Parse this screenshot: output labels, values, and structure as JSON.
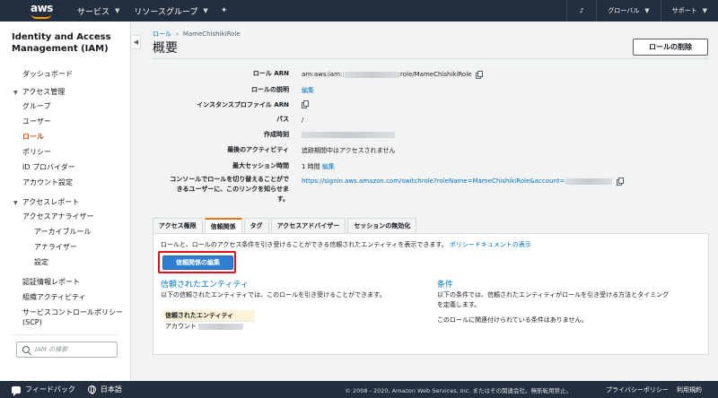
{
  "topnav": {
    "logo_text": "aws",
    "services": "サービス",
    "resource_groups": "リソースグループ",
    "pin_icon": "pin-icon",
    "region": "グローバル",
    "support": "サポート"
  },
  "sidebar": {
    "title": "Identity and Access Management (IAM)",
    "dashboard": "ダッシュボード",
    "access_mgmt": "アクセス管理",
    "groups": "グループ",
    "users": "ユーザー",
    "roles": "ロール",
    "policies": "ポリシー",
    "id_providers": "ID プロバイダー",
    "account_settings": "アカウント設定",
    "access_reports": "アクセスレポート",
    "access_analyzer": "アクセスアナライザー",
    "archive_rules": "アーカイブルール",
    "analyzers": "アナライザー",
    "settings": "設定",
    "credential_report": "認証情報レポート",
    "org_activity": "組織アクティビティ",
    "scp": "サービスコントロールポリシー (SCP)",
    "search_placeholder": "IAM の検索"
  },
  "main": {
    "breadcrumb_parent": "ロール",
    "breadcrumb_current": "MameChishikiRole",
    "title": "概要",
    "delete_button": "ロールの削除"
  },
  "details": {
    "arn_label": "ロール ARN",
    "arn_prefix": "arn:aws:iam::",
    "arn_suffix": ":role/MameChishikiRole",
    "desc_label": "ロールの説明",
    "desc_value": "編集",
    "instance_profile_label": "インスタンスプロファイル ARN",
    "path_label": "パス",
    "path_value": "/",
    "created_label": "作成時刻",
    "last_activity_label": "最後のアクティビティ",
    "last_activity_value": "追跡期間中はアクセスされません",
    "max_session_label": "最大セッション時間",
    "max_session_value": "1 時間",
    "max_session_edit": "編集",
    "switch_label": "コンソールでロールを切り替えることができるユーザーに、このリンクを知らせます。",
    "switch_url": "https://signin.aws.amazon.com/switchrole?roleName=MameChishikiRole&account="
  },
  "tabs": [
    "アクセス権限",
    "信頼関係",
    "タグ",
    "アクセスアドバイザー",
    "セッションの無効化"
  ],
  "trust": {
    "intro": "ロールと、ロールのアクセス条件を引き受けることができる信頼されたエンティティを表示できます。",
    "intro_link": "ポリシードキュメントの表示",
    "edit_button": "信頼関係の編集",
    "entities_heading": "信頼されたエンティティ",
    "entities_text": "以下の信頼されたエンティティでは、このロールを引き受けることができます。",
    "entities_col": "信頼されたエンティティ",
    "entities_row": "アカウント",
    "conditions_heading": "条件",
    "conditions_text1": "以下の条件では、信頼されたエンティティがロールを引き受ける方法とタイミング",
    "conditions_text2": "を定義します。",
    "conditions_none": "このロールに関連付けられている条件はありません。"
  },
  "footer": {
    "feedback": "フィードバック",
    "language": "日本語",
    "copyright": "© 2008 - 2020, Amazon Web Services, Inc. またはその関連会社。無断転用禁止。",
    "privacy": "プライバシーポリシー",
    "terms": "利用規約"
  },
  "colors": {
    "nav": "#232f3e",
    "accent": "#ec7211",
    "link": "#0073bb",
    "active": "#c7511f",
    "button": "#2e7fd1",
    "highlight": "#e0101d"
  }
}
